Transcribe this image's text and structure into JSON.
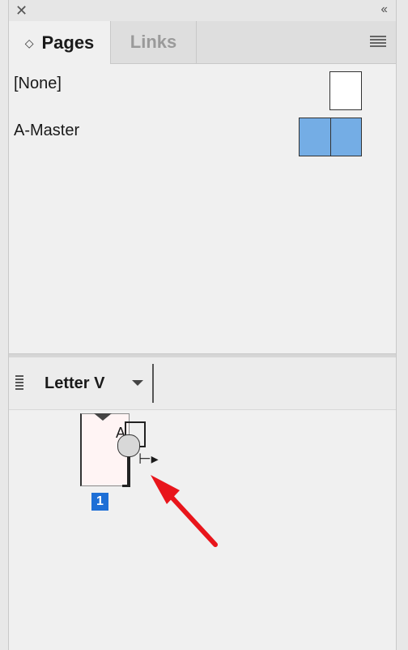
{
  "titlebar": {
    "close_glyph": "✕",
    "collapse_glyph": "‹‹"
  },
  "tabs": [
    {
      "label": "Pages",
      "active": true
    },
    {
      "label": "Links",
      "active": false
    }
  ],
  "masters": [
    {
      "label": "[None]",
      "thumbnail": "single-white"
    },
    {
      "label": "A-Master",
      "thumbnail": "spread-blue"
    }
  ],
  "page_size": {
    "label": "Letter V"
  },
  "pages": [
    {
      "number": "1",
      "master_prefix": "A"
    }
  ],
  "colors": {
    "master_thumb": "#74ade5",
    "page_number_bg": "#1e6fd6",
    "annotation_arrow": "#e8151b"
  }
}
